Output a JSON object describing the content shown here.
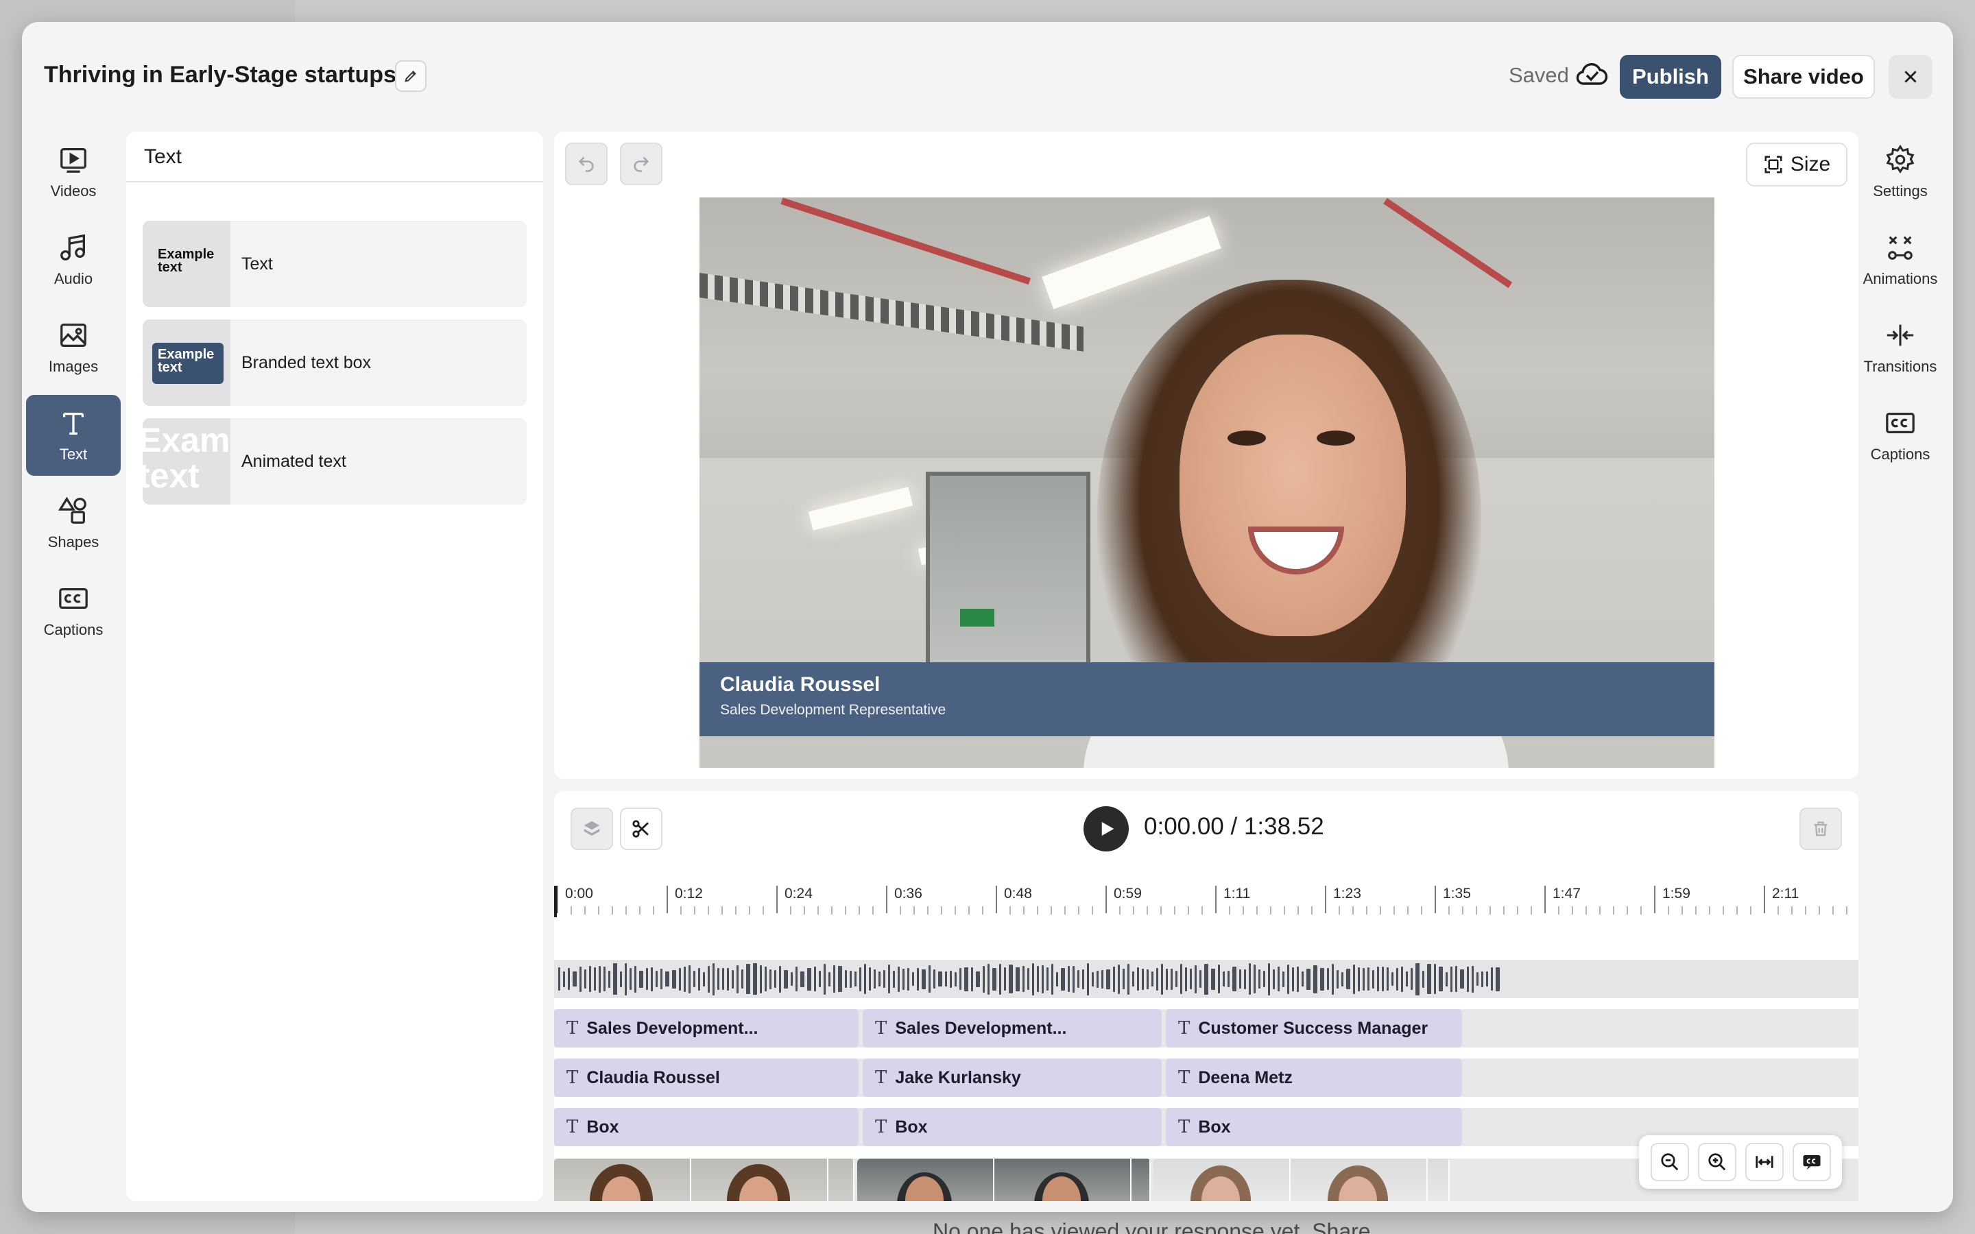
{
  "header": {
    "title": "Thriving in Early-Stage startups",
    "saved_label": "Saved",
    "publish_label": "Publish",
    "share_label": "Share video"
  },
  "left_rail": [
    {
      "label": "Videos",
      "icon": "video-play-icon"
    },
    {
      "label": "Audio",
      "icon": "music-note-icon"
    },
    {
      "label": "Images",
      "icon": "image-icon"
    },
    {
      "label": "Text",
      "icon": "text-icon",
      "active": true
    },
    {
      "label": "Shapes",
      "icon": "shapes-icon"
    },
    {
      "label": "Captions",
      "icon": "captions-icon"
    }
  ],
  "right_rail": [
    {
      "label": "Settings",
      "icon": "gear-icon"
    },
    {
      "label": "Animations",
      "icon": "animations-icon"
    },
    {
      "label": "Transitions",
      "icon": "transitions-icon"
    },
    {
      "label": "Captions",
      "icon": "captions-icon"
    }
  ],
  "text_panel": {
    "title": "Text",
    "options": [
      {
        "label": "Text",
        "thumb": "Example text"
      },
      {
        "label": "Branded text box",
        "thumb": "Example text"
      },
      {
        "label": "Animated text",
        "thumb": "Example text"
      }
    ]
  },
  "stage": {
    "size_label": "Size",
    "lower_third": {
      "name": "Claudia Roussel",
      "role": "Sales Development Representative"
    }
  },
  "timeline": {
    "time_display": "0:00.00 / 1:38.52",
    "ticks": [
      "0:00",
      "0:12",
      "0:24",
      "0:36",
      "0:48",
      "0:59",
      "1:11",
      "1:23",
      "1:35",
      "1:47",
      "1:59",
      "2:11"
    ],
    "tracks": [
      [
        "Sales Development...",
        "Sales Development...",
        "Customer Success Manager"
      ],
      [
        "Claudia Roussel",
        "Jake Kurlansky",
        "Deena Metz"
      ],
      [
        "Box",
        "Box",
        "Box"
      ]
    ]
  },
  "backdrop": {
    "hint_text": "No one has viewed your response yet. Share"
  },
  "colors": {
    "accent": "#3b5170",
    "rail_active": "#4a5e7e",
    "clip": "#d6d5ec",
    "lower_third": "#4b6181"
  }
}
